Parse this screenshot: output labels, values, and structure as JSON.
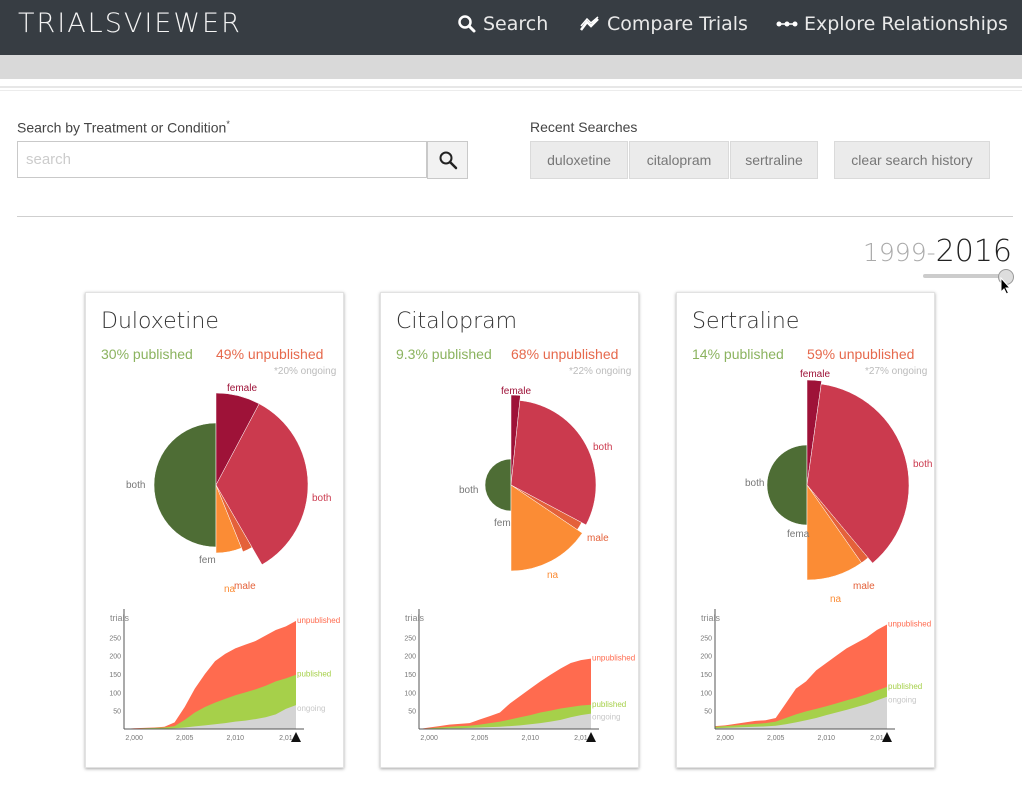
{
  "app": {
    "title": "TrialsViewer"
  },
  "nav": {
    "search": "Search",
    "compare": "Compare Trials",
    "explore": "Explore Relationships"
  },
  "search": {
    "label": "Search by Treatment or Condition",
    "required_mark": "*",
    "placeholder": "search",
    "value": ""
  },
  "recent": {
    "label": "Recent Searches",
    "items": [
      "duloxetine",
      "citalopram",
      "sertraline"
    ],
    "clear_label": "clear search history"
  },
  "year_range": {
    "start": "1999-",
    "end": "2016",
    "slider_fraction": 1.0
  },
  "colors": {
    "published_green": "#4e6d35",
    "female_dark": "#9e1238",
    "both_red": "#cb3a4e",
    "male_orange": "#e4613a",
    "na_orange": "#fb8c35",
    "unpublished_area": "#ff6b4f",
    "published_area": "#a6d04a",
    "ongoing_area": "#d4d4d4"
  },
  "cards": [
    {
      "title": "Duloxetine",
      "published": "30% published",
      "unpublished": "49% unpublished",
      "ongoing": "*20% ongoing",
      "pie_labels": {
        "female": "female",
        "both_right": "both",
        "male": "male",
        "na": "na",
        "both_left": "both",
        "fem_left": "fem"
      },
      "chart": {
        "ylabel": "trials",
        "yticks": [
          "250",
          "200",
          "150",
          "100",
          "50"
        ],
        "xticks": [
          "2,000",
          "2,005",
          "2,010",
          "2,01"
        ],
        "series_labels": [
          "unpublished",
          "published",
          "ongoing"
        ],
        "years": [
          1999,
          2000,
          2001,
          2002,
          2003,
          2004,
          2005,
          2006,
          2007,
          2008,
          2009,
          2010,
          2011,
          2012,
          2013,
          2014,
          2015,
          2016
        ],
        "unpublished": [
          0,
          2,
          3,
          4,
          6,
          18,
          60,
          110,
          150,
          185,
          205,
          220,
          230,
          240,
          255,
          270,
          280,
          295
        ],
        "published": [
          0,
          1,
          2,
          3,
          4,
          8,
          25,
          45,
          60,
          72,
          82,
          92,
          100,
          108,
          118,
          130,
          138,
          148
        ],
        "ongoing": [
          0,
          0,
          1,
          1,
          1,
          2,
          4,
          7,
          10,
          13,
          16,
          20,
          23,
          27,
          32,
          40,
          55,
          65
        ]
      }
    },
    {
      "title": "Citalopram",
      "published": "9.3% published",
      "unpublished": "68% unpublished",
      "ongoing": "*22% ongoing",
      "pie_labels": {
        "female": "female",
        "both_right": "both",
        "male": "male",
        "na": "na",
        "both_left": "both",
        "fem_left": "fem"
      },
      "chart": {
        "ylabel": "trials",
        "yticks": [
          "250",
          "200",
          "150",
          "100",
          "50"
        ],
        "xticks": [
          "2,000",
          "2,005",
          "2,010",
          "2,01"
        ],
        "series_labels": [
          "unpublished",
          "published",
          "ongoing"
        ],
        "years": [
          1999,
          2000,
          2001,
          2002,
          2003,
          2004,
          2005,
          2006,
          2007,
          2008,
          2009,
          2010,
          2011,
          2012,
          2013,
          2014,
          2015,
          2016
        ],
        "unpublished": [
          0,
          4,
          8,
          12,
          14,
          16,
          26,
          35,
          45,
          70,
          90,
          110,
          130,
          148,
          165,
          180,
          188,
          192
        ],
        "published": [
          0,
          2,
          4,
          6,
          8,
          9,
          12,
          16,
          20,
          26,
          32,
          38,
          45,
          50,
          56,
          60,
          64,
          66
        ],
        "ongoing": [
          0,
          1,
          1,
          2,
          2,
          3,
          4,
          5,
          6,
          8,
          10,
          13,
          16,
          20,
          25,
          32,
          38,
          42
        ]
      }
    },
    {
      "title": "Sertraline",
      "published": "14% published",
      "unpublished": "59% unpublished",
      "ongoing": "*27% ongoing",
      "pie_labels": {
        "female": "female",
        "both_right": "both",
        "male": "male",
        "na": "na",
        "both_left": "both",
        "fem_left": "fema"
      },
      "chart": {
        "ylabel": "trials",
        "yticks": [
          "250",
          "200",
          "150",
          "100",
          "50"
        ],
        "xticks": [
          "2,000",
          "2,005",
          "2,010",
          "2,01"
        ],
        "series_labels": [
          "unpublished",
          "published",
          "ongoing"
        ],
        "years": [
          1999,
          2000,
          2001,
          2002,
          2003,
          2004,
          2005,
          2006,
          2007,
          2008,
          2009,
          2010,
          2011,
          2012,
          2013,
          2014,
          2015,
          2016
        ],
        "unpublished": [
          8,
          10,
          14,
          18,
          22,
          24,
          30,
          70,
          110,
          130,
          160,
          180,
          200,
          220,
          235,
          250,
          270,
          285
        ],
        "published": [
          6,
          8,
          10,
          12,
          14,
          16,
          20,
          30,
          40,
          48,
          55,
          62,
          70,
          78,
          86,
          95,
          105,
          115
        ],
        "ongoing": [
          2,
          3,
          4,
          5,
          6,
          7,
          9,
          13,
          18,
          24,
          30,
          38,
          45,
          52,
          60,
          68,
          78,
          88
        ]
      }
    }
  ]
}
